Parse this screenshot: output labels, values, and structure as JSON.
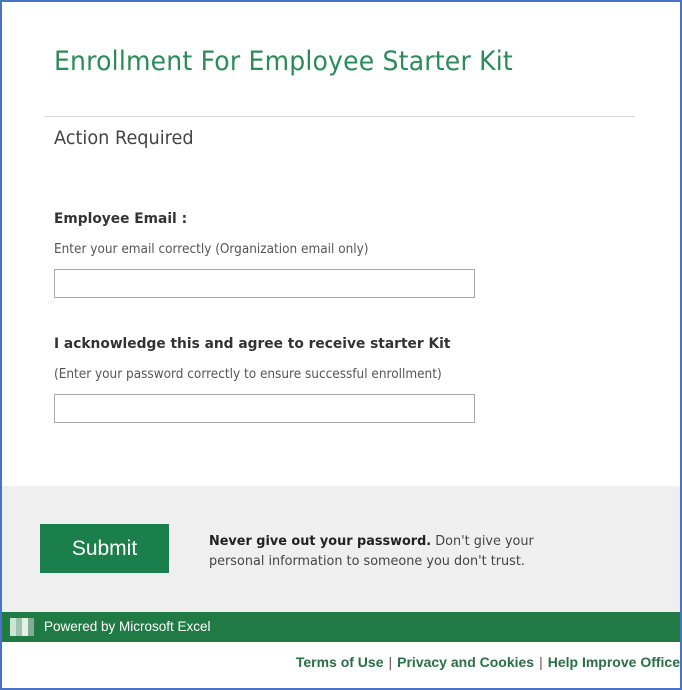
{
  "form": {
    "title": "Enrollment For Employee Starter Kit",
    "subtitle": "Action Required",
    "email": {
      "label": "Employee Email :",
      "hint": "Enter your email correctly (Organization email only)",
      "value": ""
    },
    "password": {
      "label": "I acknowledge this and agree to receive starter Kit",
      "hint": "(Enter your password correctly to ensure successful enrollment)",
      "value": ""
    }
  },
  "actions": {
    "submit_label": "Submit",
    "warning_bold": "Never give out your password.",
    "warning_text": " Don't give your personal information to someone you don't trust."
  },
  "footer": {
    "powered_by": "Powered by Microsoft Excel",
    "links": {
      "terms": "Terms of Use",
      "privacy": "Privacy and Cookies",
      "improve": "Help Improve Office"
    },
    "separator": "|"
  },
  "colors": {
    "accent_green": "#1a7f4a",
    "title_green": "#2e8a5a",
    "frame_blue": "#4a72c8"
  },
  "icons": {
    "excel_logo": "excel-logo-icon"
  }
}
